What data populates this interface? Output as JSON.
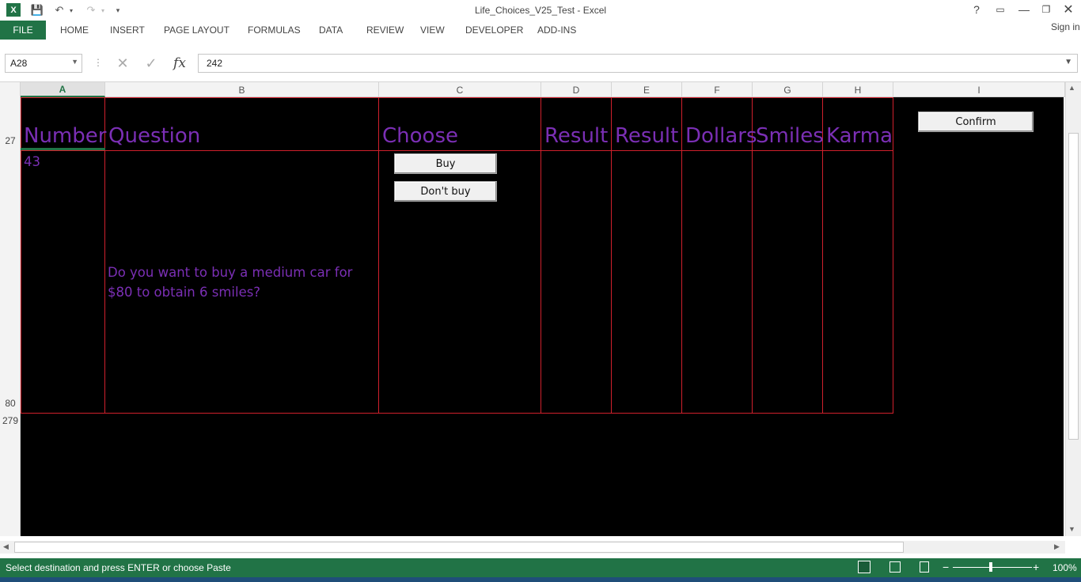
{
  "window": {
    "title": "Life_Choices_V25_Test - Excel",
    "help": "?",
    "sign_in": "Sign in"
  },
  "ribbon": {
    "tabs": [
      "FILE",
      "HOME",
      "INSERT",
      "PAGE LAYOUT",
      "FORMULAS",
      "DATA",
      "REVIEW",
      "VIEW",
      "DEVELOPER",
      "ADD-INS"
    ]
  },
  "formula_bar": {
    "name_box": "A28",
    "formula": "242",
    "fx": "fx"
  },
  "columns": [
    "A",
    "B",
    "C",
    "D",
    "E",
    "F",
    "G",
    "H",
    "I"
  ],
  "rows": [
    "27",
    "80",
    "279"
  ],
  "table": {
    "headers": [
      "Number",
      "Question",
      "Choose",
      "Result",
      "Result",
      "Dollars",
      "Smiles",
      "Karma"
    ],
    "number": "43",
    "question": "Do you want to buy a medium car for $80 to obtain 6 smiles?"
  },
  "buttons": {
    "buy": "Buy",
    "dont_buy": "Don't buy",
    "confirm": "Confirm"
  },
  "status": {
    "message": "Select destination and press ENTER or choose Paste",
    "zoom": "100%"
  },
  "colors": {
    "excel_green": "#217346",
    "header_purple": "#7b2fb5",
    "grid_red": "#d0202c"
  }
}
